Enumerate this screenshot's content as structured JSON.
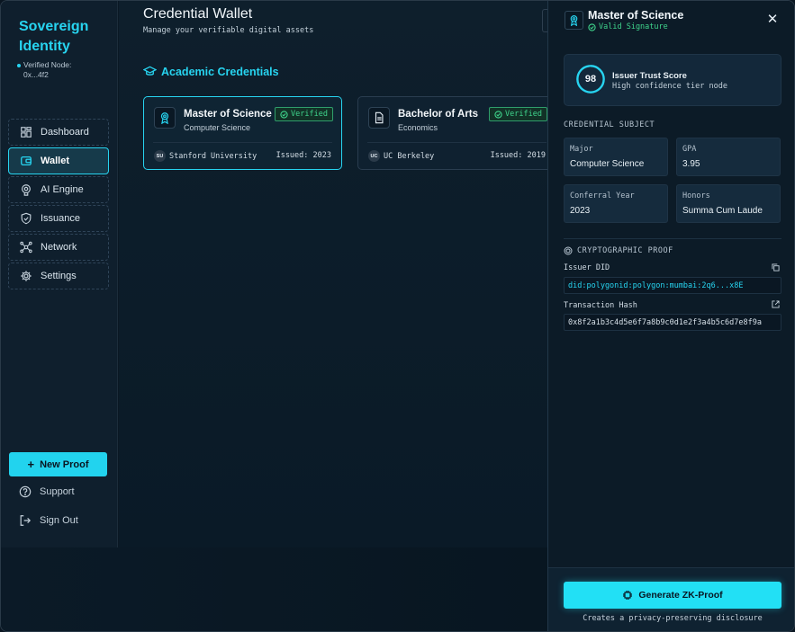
{
  "sidebar": {
    "brand": "Sovereign Identity",
    "node_label": "Verified Node:",
    "node_id": "0x...4f2",
    "items": [
      {
        "label": "Dashboard",
        "icon": "grid-icon"
      },
      {
        "label": "Wallet",
        "icon": "wallet-icon",
        "active": true
      },
      {
        "label": "AI Engine",
        "icon": "brain-icon"
      },
      {
        "label": "Issuance",
        "icon": "shield-check-icon"
      },
      {
        "label": "Network",
        "icon": "network-icon"
      },
      {
        "label": "Settings",
        "icon": "gear-icon"
      }
    ],
    "new_proof": "New Proof",
    "support": "Support",
    "sign_out": "Sign Out"
  },
  "main": {
    "title": "Credential Wallet",
    "subtitle": "Manage your verifiable digital assets",
    "section": "Academic Credentials",
    "cards": [
      {
        "title": "Master of Science",
        "subtitle": "Computer Science",
        "badge": "Verified",
        "issuer_abbr": "SU",
        "issuer": "Stanford University",
        "issued": "Issued: 2023",
        "icon": "award-icon"
      },
      {
        "title": "Bachelor of Arts",
        "subtitle": "Economics",
        "badge": "Verified",
        "issuer_abbr": "UC",
        "issuer": "UC Berkeley",
        "issued": "Issued: 2019",
        "icon": "document-icon"
      }
    ]
  },
  "panel": {
    "title": "Master of Science",
    "signature": "Valid Signature",
    "trust": {
      "score": "98",
      "score_value": 98,
      "title": "Issuer Trust Score",
      "subtitle": "High confidence tier node"
    },
    "subject_label": "CREDENTIAL SUBJECT",
    "fields": [
      {
        "key": "Major",
        "value": "Computer Science"
      },
      {
        "key": "GPA",
        "value": "3.95"
      },
      {
        "key": "Conferral Year",
        "value": "2023"
      },
      {
        "key": "Honors",
        "value": "Summa Cum Laude"
      }
    ],
    "proof_label": "CRYPTOGRAPHIC PROOF",
    "did_label": "Issuer DID",
    "did_value": "did:polygonid:polygon:mumbai:2q6...x8E",
    "hash_label": "Transaction Hash",
    "hash_value": "0x8f2a1b3c4d5e6f7a8b9c0d1e2f3a4b5c6d7e8f9a",
    "generate": "Generate ZK-Proof",
    "footnote": "Creates a privacy-preserving disclosure"
  },
  "colors": {
    "accent": "#27d4f0",
    "verified": "#3fd48c",
    "background": "#0b1824"
  }
}
